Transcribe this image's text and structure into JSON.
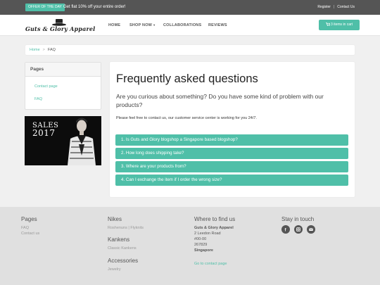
{
  "topbar": {
    "offer_badge": "OFFER OF THE DAY",
    "offer_text": "Get flat 10% off your entire order!",
    "login": "Register",
    "separator": "|",
    "contact": "Contact Us"
  },
  "navbar": {
    "logo_text": "Guts & Glory Apparel",
    "items": [
      "HOME",
      "SHOP NOW",
      "COLLABORATIONS",
      "REVIEWS"
    ],
    "cart_label": "3 items in cart",
    "cart_icon": "cart-icon"
  },
  "breadcrumb": {
    "home": "Home",
    "separator": ">",
    "current": "FAQ"
  },
  "sidebar": {
    "title": "Pages",
    "links": [
      "Contact page",
      "FAQ"
    ],
    "banner_line1": "SALES",
    "banner_line2": "2017"
  },
  "faq": {
    "title": "Frequently asked questions",
    "lead": "Are you curious about something? Do you have some kind of problem with our products?",
    "note": "Please feel free to contact us, our customer service center is working for you 24/7.",
    "questions": [
      "1. Is Guts and Glory blogshop a Singapore based blogshop?",
      "2. How long does shipping take?",
      "3. Where are your products from?",
      "4. Can I exchange the item if I order the wrong size?"
    ]
  },
  "footer": {
    "pages_title": "Pages",
    "pages_links": [
      "FAQ",
      "Contact us"
    ],
    "nikes_title": "Nikes",
    "nikes_link_a": "Roshenuns",
    "nikes_link_sep": "|",
    "nikes_link_b": "Flyknits",
    "kankens_title": "Kankens",
    "kankens_link": "Classic Kankens",
    "accessories_title": "Accessories",
    "accessories_link": "Jewelry",
    "find_title": "Where to find us",
    "address": [
      "Guts & Glory Apparel",
      "2 Leedon Road",
      "#00-00",
      "267829",
      "Singapore"
    ],
    "goto_contact": "Go to contact page",
    "stay_title": "Stay in touch",
    "social_icons": [
      "facebook-icon",
      "instagram-icon",
      "email-icon"
    ]
  },
  "colors": {
    "accent": "#4fbfa8",
    "topbar": "#555555",
    "footer": "#e0e0e0"
  }
}
